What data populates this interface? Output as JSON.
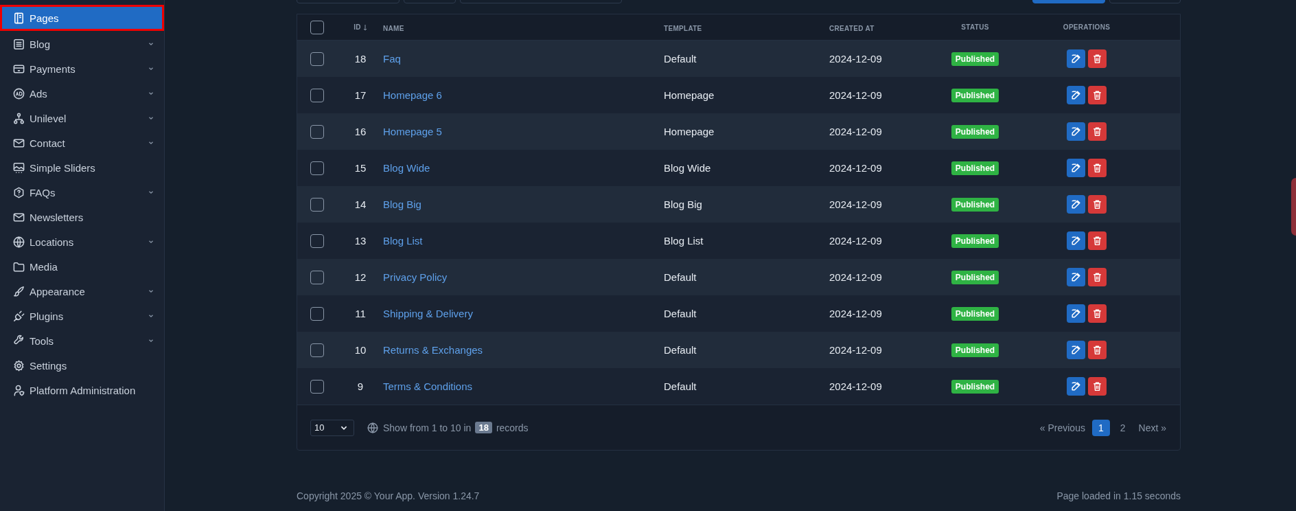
{
  "sidebar": {
    "items": [
      {
        "label": "Pages",
        "selected": true,
        "has_children": false
      },
      {
        "label": "Blog",
        "selected": false,
        "has_children": true
      },
      {
        "label": "Payments",
        "selected": false,
        "has_children": true
      },
      {
        "label": "Ads",
        "selected": false,
        "has_children": true
      },
      {
        "label": "Unilevel",
        "selected": false,
        "has_children": true
      },
      {
        "label": "Contact",
        "selected": false,
        "has_children": true
      },
      {
        "label": "Simple Sliders",
        "selected": false,
        "has_children": false
      },
      {
        "label": "FAQs",
        "selected": false,
        "has_children": true
      },
      {
        "label": "Newsletters",
        "selected": false,
        "has_children": false
      },
      {
        "label": "Locations",
        "selected": false,
        "has_children": true
      },
      {
        "label": "Media",
        "selected": false,
        "has_children": false
      },
      {
        "label": "Appearance",
        "selected": false,
        "has_children": true
      },
      {
        "label": "Plugins",
        "selected": false,
        "has_children": true
      },
      {
        "label": "Tools",
        "selected": false,
        "has_children": true
      },
      {
        "label": "Settings",
        "selected": false,
        "has_children": false
      },
      {
        "label": "Platform Administration",
        "selected": false,
        "has_children": false
      }
    ]
  },
  "table": {
    "all_checked": false,
    "columns": [
      "ID",
      "NAME",
      "TEMPLATE",
      "CREATED AT",
      "STATUS",
      "OPERATIONS"
    ],
    "rows": [
      {
        "id": "18",
        "name": "Faq",
        "template": "Default",
        "created_at": "2024-12-09",
        "status": "Published",
        "checked": false
      },
      {
        "id": "17",
        "name": "Homepage 6",
        "template": "Homepage",
        "created_at": "2024-12-09",
        "status": "Published",
        "checked": false
      },
      {
        "id": "16",
        "name": "Homepage 5",
        "template": "Homepage",
        "created_at": "2024-12-09",
        "status": "Published",
        "checked": false
      },
      {
        "id": "15",
        "name": "Blog Wide",
        "template": "Blog Wide",
        "created_at": "2024-12-09",
        "status": "Published",
        "checked": false
      },
      {
        "id": "14",
        "name": "Blog Big",
        "template": "Blog Big",
        "created_at": "2024-12-09",
        "status": "Published",
        "checked": false
      },
      {
        "id": "13",
        "name": "Blog List",
        "template": "Blog List",
        "created_at": "2024-12-09",
        "status": "Published",
        "checked": false
      },
      {
        "id": "12",
        "name": "Privacy Policy",
        "template": "Default",
        "created_at": "2024-12-09",
        "status": "Published",
        "checked": false
      },
      {
        "id": "11",
        "name": "Shipping & Delivery",
        "template": "Default",
        "created_at": "2024-12-09",
        "status": "Published",
        "checked": false
      },
      {
        "id": "10",
        "name": "Returns & Exchanges",
        "template": "Default",
        "created_at": "2024-12-09",
        "status": "Published",
        "checked": false
      },
      {
        "id": "9",
        "name": "Terms & Conditions",
        "template": "Default",
        "created_at": "2024-12-09",
        "status": "Published",
        "checked": false
      }
    ]
  },
  "pagination": {
    "per_page": "10",
    "info_before": "Show from 1 to 10 in",
    "total": "18",
    "info_after": "records",
    "previous": "« Previous",
    "pages": [
      {
        "label": "1",
        "selected": true
      },
      {
        "label": "2",
        "selected": false
      }
    ],
    "next": "Next »"
  },
  "footer": {
    "copyright": "Copyright 2025 © Your App. Version 1.24.7",
    "load_time": "Page loaded in 1.15 seconds"
  }
}
